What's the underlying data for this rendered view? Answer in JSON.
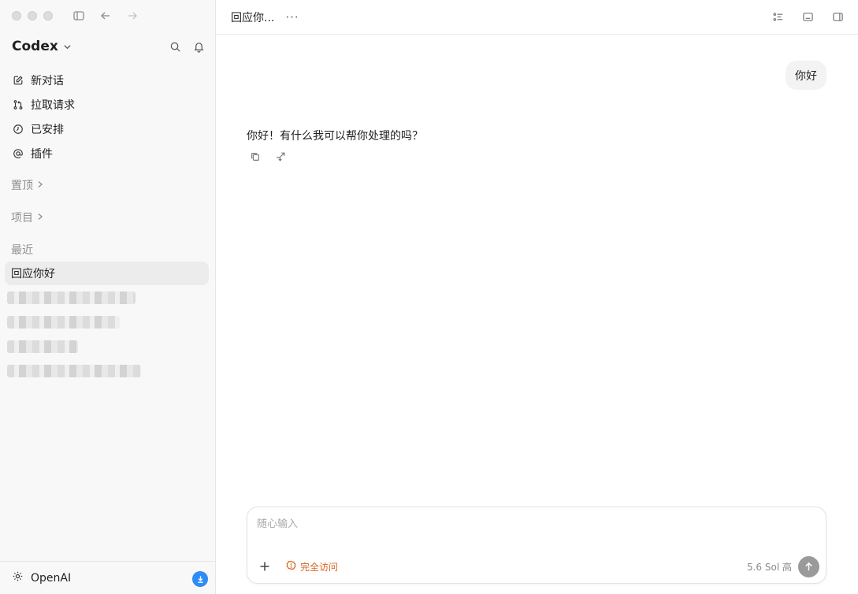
{
  "window": {
    "title": "回应你..."
  },
  "sidebar": {
    "brand": "Codex",
    "nav": [
      {
        "label": "新对话",
        "icon": "edit-icon"
      },
      {
        "label": "拉取请求",
        "icon": "pull-request-icon"
      },
      {
        "label": "已安排",
        "icon": "clock-icon"
      },
      {
        "label": "插件",
        "icon": "at-icon"
      }
    ],
    "sections": {
      "pinned": "置顶",
      "projects": "项目",
      "recent": "最近"
    },
    "recent": [
      {
        "label": "回应你好",
        "active": true
      }
    ],
    "footer": {
      "label": "OpenAI"
    }
  },
  "main": {
    "title": "回应你...",
    "more": "···",
    "messages": {
      "user": "你好",
      "assistant": "你好！有什么我可以帮你处理的吗？"
    },
    "composer": {
      "placeholder": "随心输入",
      "access": "完全访问",
      "model": "5.6 Sol 高"
    }
  },
  "colors": {
    "accent_warning": "#d7651e",
    "download_badge": "#2f8cf4",
    "active_item_bg": "#ececec"
  }
}
